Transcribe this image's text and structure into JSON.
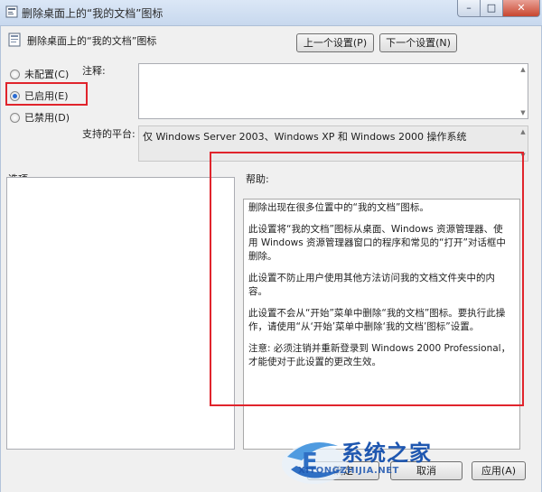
{
  "window": {
    "title": "删除桌面上的“我的文档”图标",
    "minimize_glyph": "–",
    "maximize_glyph": "□",
    "close_glyph": "✕"
  },
  "header": {
    "policy_name": "删除桌面上的“我的文档”图标",
    "prev_button": "上一个设置(P)",
    "next_button": "下一个设置(N)"
  },
  "state_options": [
    {
      "label": "未配置(C)",
      "checked": false
    },
    {
      "label": "已启用(E)",
      "checked": true
    },
    {
      "label": "已禁用(D)",
      "checked": false
    }
  ],
  "comment": {
    "label": "注释:",
    "value": ""
  },
  "supported_on": {
    "label": "支持的平台:",
    "value": "仅 Windows Server 2003、Windows XP 和 Windows 2000 操作系统"
  },
  "options_label": "选项:",
  "help": {
    "label": "帮助:",
    "paragraphs": [
      "删除出现在很多位置中的“我的文档”图标。",
      "此设置将“我的文档”图标从桌面、Windows 资源管理器、使用 Windows 资源管理器窗口的程序和常见的“打开”对话框中删除。",
      "此设置不防止用户使用其他方法访问我的文档文件夹中的内容。",
      "此设置不会从“开始”菜单中删除“我的文档”图标。要执行此操作，请使用“从‘开始’菜单中删除‘我的文档’图标”设置。",
      "注意: 必须注销并重新登录到 Windows 2000 Professional，才能使对于此设置的更改生效。"
    ]
  },
  "footer": {
    "ok_button": "确定",
    "cancel_button": "取消",
    "apply_button": "应用(A)"
  },
  "watermark": {
    "brand": "系统之家",
    "domain": "XITONGZHIJIA.NET"
  },
  "colors": {
    "highlight_red": "#e0242c",
    "radio_selected": "#2a6bd2"
  }
}
